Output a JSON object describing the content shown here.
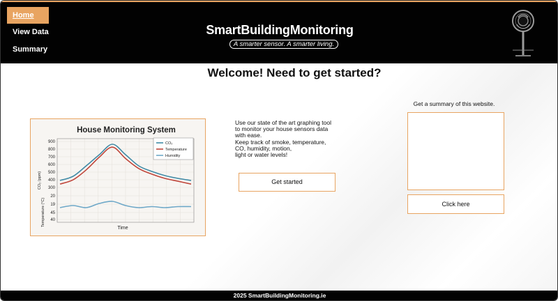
{
  "nav": {
    "items": [
      {
        "label": "Home",
        "active": true
      },
      {
        "label": "View Data",
        "active": false
      },
      {
        "label": "Summary",
        "active": false
      }
    ]
  },
  "header": {
    "title": "SmartBuildingMonitoring",
    "tagline": "A smarter sensor. A smarter living.",
    "logo_icon": "sensor-logo-icon"
  },
  "main": {
    "welcome": "Welcome! Need to get started?",
    "description_lines": [
      "Use our state of the art graphing tool",
      "to monitor your house sensors data",
      "with ease.",
      "Keep track of smoke, temperature,",
      "CO, humidity, motion,",
      "light or water levels!"
    ],
    "get_started_label": "Get started",
    "summary_label": "Get a summary of this website.",
    "click_here_label": "Click here"
  },
  "footer": {
    "text": "2025 SmartBuildingMonitoring.ie"
  },
  "colors": {
    "accent": "#e8a461",
    "header_bg": "#020202",
    "co2": "#3f8aa6",
    "temperature": "#c0463b",
    "humidity": "#6ea8c8"
  },
  "chart_data": {
    "type": "line",
    "title": "House Monitoring System",
    "xlabel": "Time",
    "ylabel_co2": "CO₂ (ppm)",
    "ylabel_temp": "Temperature (°C)",
    "ytick_labels": [
      "900",
      "800",
      "700",
      "600",
      "500",
      "400",
      "300",
      "20",
      "19",
      "45",
      "40"
    ],
    "x": [
      0,
      1,
      2,
      3,
      4,
      5,
      6,
      7,
      8,
      9,
      10
    ],
    "series": [
      {
        "name": "CO₂",
        "values": [
          350,
          410,
          560,
          720,
          870,
          720,
          560,
          480,
          420,
          380,
          350
        ]
      },
      {
        "name": "Temperature",
        "values": [
          19.3,
          19.6,
          20.3,
          21.2,
          21.9,
          21.1,
          20.4,
          20.0,
          19.7,
          19.5,
          19.3
        ]
      },
      {
        "name": "Humidity",
        "values": [
          47,
          48,
          47,
          49,
          50,
          48,
          47,
          47.5,
          47,
          47.5,
          47.5
        ]
      }
    ],
    "legend": "top-right",
    "grid": true
  }
}
